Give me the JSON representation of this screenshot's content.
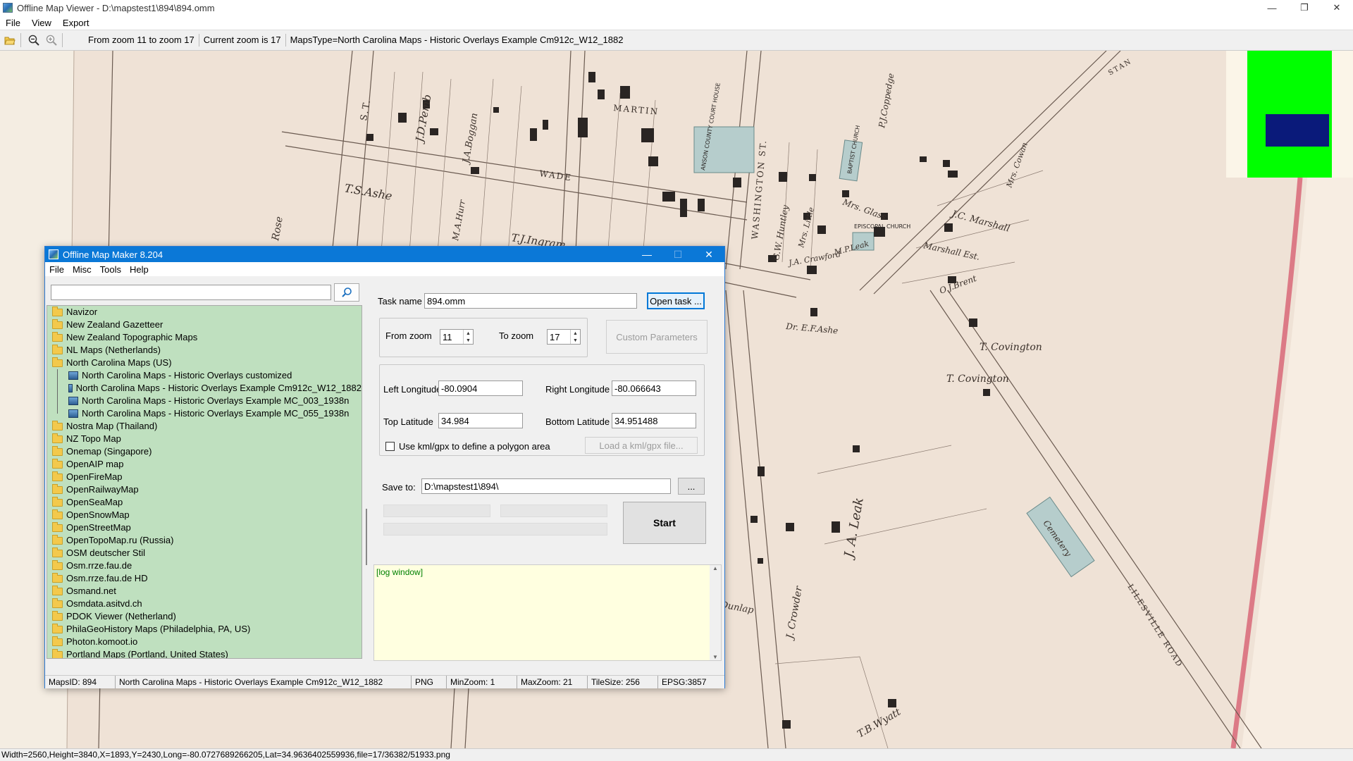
{
  "viewer": {
    "title": "Offline Map Viewer - D:\\mapstest1\\894\\894.omm",
    "menu": [
      "File",
      "View",
      "Export"
    ],
    "toolbar": {
      "zoom_range": "From zoom 11 to zoom 17",
      "current_zoom": "Current zoom is 17",
      "maps_type": "MapsType=North Carolina Maps - Historic Overlays Example Cm912c_W12_1882"
    },
    "status": "Width=2560,Height=3840,X=1893,Y=2430,Long=-80.0727689266205,Lat=34.9636402559936,file=17/36382/51933.png",
    "overview_colors": {
      "frame": "#00ff00",
      "viewport": "#0a1a7a"
    }
  },
  "map_labels": {
    "martin": "MARTIN",
    "wade": "WADE",
    "washington": "WASHINGTON ST.",
    "st": "S.T.",
    "ashe": "T.S.Ashe",
    "ingram": "T.J.Ingram",
    "jd_pemb": "J.D.Pemb",
    "boggan": "J.A.Boggan",
    "court_house": "ANSON COUNTY COURT HOUSE",
    "baptist": "BAPTIST CHURCH",
    "episcopal": "EPISCOPAL CHURCH",
    "covington1": "T. Covington",
    "covington2": "T. Covington",
    "cemetery": "Cemetery",
    "lilesville": "LILESVILLE ROAD",
    "leak": "J. A. Leak",
    "crowder": "J. Crowder",
    "wyatt": "T.B.Wyatt",
    "dunlap": "Dunlap",
    "ashe_dr": "Dr. E.F.Ashe",
    "marshall": "J.C. Marshall",
    "marshall_est": "Marshall Est.",
    "brent": "O.J.Brent",
    "cowan": "Mrs. Cowan",
    "coppedge": "P.J.Coppedge",
    "rose": "Rose",
    "bennett": "Mrs. Glass",
    "huntley": "G.W. Huntley",
    "little": "Mrs. Little",
    "leak2": "M.P.Leak",
    "crawford": "J.A. Crawford",
    "hurr": "M.A.Hurr",
    "stan": "STAN"
  },
  "dialog": {
    "title": "Offline Map Maker 8.204",
    "menu": [
      "File",
      "Misc",
      "Tools",
      "Help"
    ],
    "search_placeholder": "",
    "tree": [
      {
        "label": "Navizor",
        "level": 0,
        "type": "folder"
      },
      {
        "label": "New Zealand Gazetteer",
        "level": 0,
        "type": "folder"
      },
      {
        "label": "New Zealand Topographic Maps",
        "level": 0,
        "type": "folder"
      },
      {
        "label": "NL Maps (Netherlands)",
        "level": 0,
        "type": "folder"
      },
      {
        "label": "North Carolina Maps (US)",
        "level": 0,
        "type": "folder-open"
      },
      {
        "label": "North Carolina Maps - Historic Overlays customized",
        "level": 1,
        "type": "map"
      },
      {
        "label": "North Carolina Maps - Historic Overlays Example Cm912c_W12_1882",
        "level": 1,
        "type": "map"
      },
      {
        "label": "North Carolina Maps - Historic Overlays Example MC_003_1938n",
        "level": 1,
        "type": "map"
      },
      {
        "label": "North Carolina Maps - Historic Overlays Example MC_055_1938n",
        "level": 1,
        "type": "map"
      },
      {
        "label": "Nostra Map (Thailand)",
        "level": 0,
        "type": "folder"
      },
      {
        "label": "NZ Topo Map",
        "level": 0,
        "type": "folder"
      },
      {
        "label": "Onemap (Singapore)",
        "level": 0,
        "type": "folder"
      },
      {
        "label": "OpenAIP map",
        "level": 0,
        "type": "folder"
      },
      {
        "label": "OpenFireMap",
        "level": 0,
        "type": "folder"
      },
      {
        "label": "OpenRailwayMap",
        "level": 0,
        "type": "folder"
      },
      {
        "label": "OpenSeaMap",
        "level": 0,
        "type": "folder"
      },
      {
        "label": "OpenSnowMap",
        "level": 0,
        "type": "folder"
      },
      {
        "label": "OpenStreetMap",
        "level": 0,
        "type": "folder"
      },
      {
        "label": "OpenTopoMap.ru (Russia)",
        "level": 0,
        "type": "folder"
      },
      {
        "label": "OSM deutscher Stil",
        "level": 0,
        "type": "folder"
      },
      {
        "label": "Osm.rrze.fau.de",
        "level": 0,
        "type": "folder"
      },
      {
        "label": "Osm.rrze.fau.de HD",
        "level": 0,
        "type": "folder"
      },
      {
        "label": "Osmand.net",
        "level": 0,
        "type": "folder"
      },
      {
        "label": "Osmdata.asitvd.ch",
        "level": 0,
        "type": "folder"
      },
      {
        "label": "PDOK Viewer (Netherland)",
        "level": 0,
        "type": "folder"
      },
      {
        "label": "PhilaGeoHistory Maps (Philadelphia, PA, US)",
        "level": 0,
        "type": "folder"
      },
      {
        "label": "Photon.komoot.io",
        "level": 0,
        "type": "folder"
      },
      {
        "label": "Portland Maps (Portland, United States)",
        "level": 0,
        "type": "folder"
      }
    ],
    "task": {
      "name_label": "Task name",
      "name_value": "894.omm",
      "open_task": "Open task ..."
    },
    "zoom": {
      "from_label": "From zoom",
      "from_value": "11",
      "to_label": "To zoom",
      "to_value": "17",
      "custom_params": "Custom Parameters"
    },
    "bounds": {
      "left_lon_label": "Left Longitude",
      "left_lon_value": "-80.0904",
      "right_lon_label": "Right Longitude",
      "right_lon_value": "-80.066643",
      "top_lat_label": "Top Latitude",
      "top_lat_value": "34.984",
      "bottom_lat_label": "Bottom Latitude",
      "bottom_lat_value": "34.951488",
      "kml_checkbox_label": "Use kml/gpx to define a polygon area",
      "kml_checked": false,
      "load_kml": "Load a kml/gpx file..."
    },
    "save": {
      "label": "Save to:",
      "value": "D:\\mapstest1\\894\\",
      "browse": "..."
    },
    "start": "Start",
    "log_text": "[log window]",
    "status": {
      "maps_id": "MapsID: 894",
      "maps_name": "North Carolina Maps - Historic Overlays Example Cm912c_W12_1882",
      "format": "PNG",
      "min_zoom": "MinZoom: 1",
      "max_zoom": "MaxZoom: 21",
      "tile_size": "TileSize: 256",
      "epsg": "EPSG:3857"
    }
  }
}
